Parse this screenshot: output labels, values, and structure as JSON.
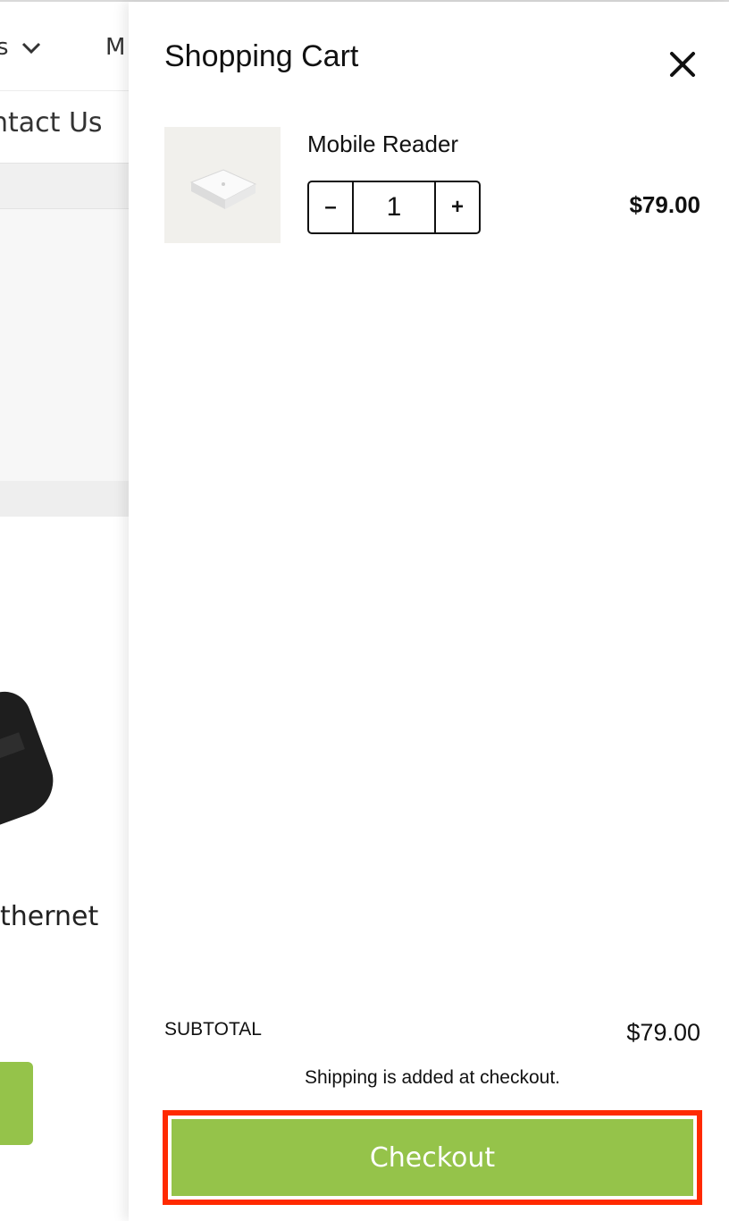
{
  "background_page": {
    "nav_fragment_1": "s",
    "nav_fragment_2": "M",
    "contact_fragment": "ntact Us",
    "product_fragment": "thernet"
  },
  "cart": {
    "title": "Shopping Cart",
    "items": [
      {
        "name": "Mobile Reader",
        "quantity": "1",
        "price": "$79.00",
        "minus_label": "–",
        "plus_label": "+"
      }
    ],
    "subtotal_label": "SUBTOTAL",
    "subtotal_value": "$79.00",
    "shipping_note": "Shipping is added at checkout.",
    "checkout_label": "Checkout"
  },
  "colors": {
    "checkout_green": "#95c34a",
    "highlight_red": "#ff2a00"
  },
  "icons": {
    "close": "close-icon",
    "nav_dropdown": "chevron-down-icon"
  }
}
